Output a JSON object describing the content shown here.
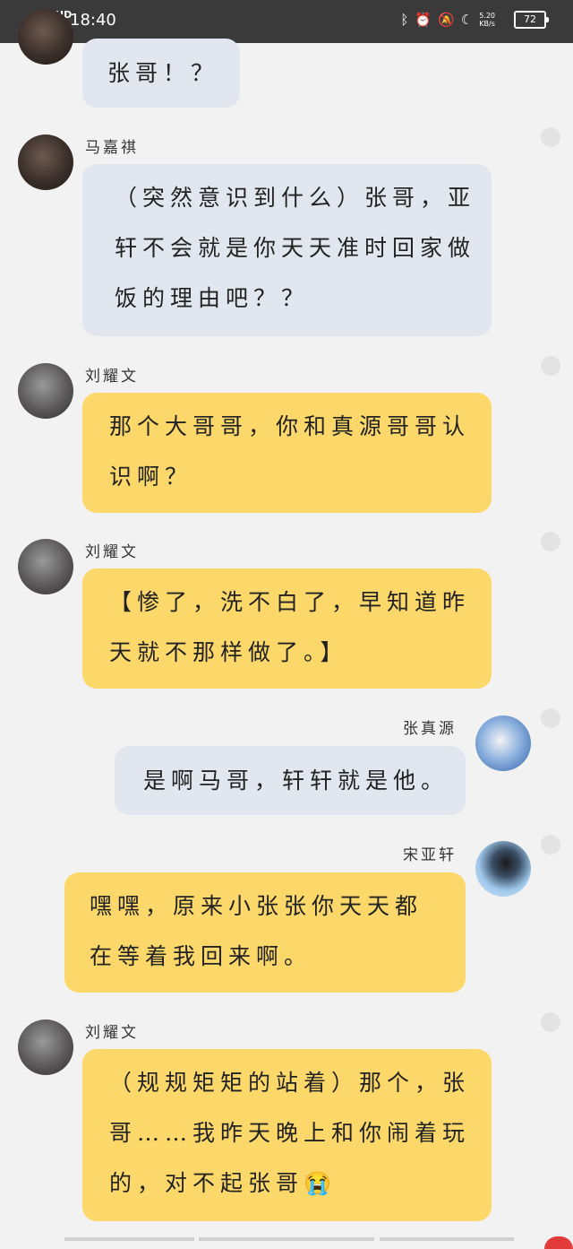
{
  "status_bar": {
    "network": "4G+HD",
    "time": "18:40",
    "speed_value": "5.20",
    "speed_unit": "KB/s",
    "battery": "72",
    "icons": [
      "bluetooth-icon",
      "alarm-icon",
      "mute-icon",
      "moon-icon"
    ]
  },
  "messages": [
    {
      "sender": "",
      "side": "left",
      "bubble_color": "#e2e6ee",
      "lines": [
        "张哥！？"
      ]
    },
    {
      "sender": "马嘉祺",
      "side": "left",
      "bubble_color": "#e2e6ee",
      "lines": [
        "（突然意识到什么）张哥，亚",
        "轩不会就是你天天准时回家做",
        "饭的理由吧？？"
      ]
    },
    {
      "sender": "刘耀文",
      "side": "left",
      "bubble_color": "#fcd86b",
      "lines": [
        "那个大哥哥，你和真源哥哥认",
        "识啊？"
      ]
    },
    {
      "sender": "刘耀文",
      "side": "left",
      "bubble_color": "#fcd86b",
      "lines": [
        "【惨了，洗不白了，早知道昨",
        "天就不那样做了。】"
      ]
    },
    {
      "sender": "张真源",
      "side": "right",
      "bubble_color": "#e2e6ee",
      "lines": [
        "是啊马哥，轩轩就是他。"
      ]
    },
    {
      "sender": "宋亚轩",
      "side": "right",
      "bubble_color": "#fcd86b",
      "lines": [
        "嘿嘿，原来小张张你天天都",
        "在等着我回来啊。"
      ]
    },
    {
      "sender": "刘耀文",
      "side": "left",
      "bubble_color": "#fcd86b",
      "lines": [
        "（规规矩矩的站着）那个，张",
        "哥……我昨天晚上和你闹着玩",
        "的，对不起张哥😭"
      ]
    }
  ]
}
